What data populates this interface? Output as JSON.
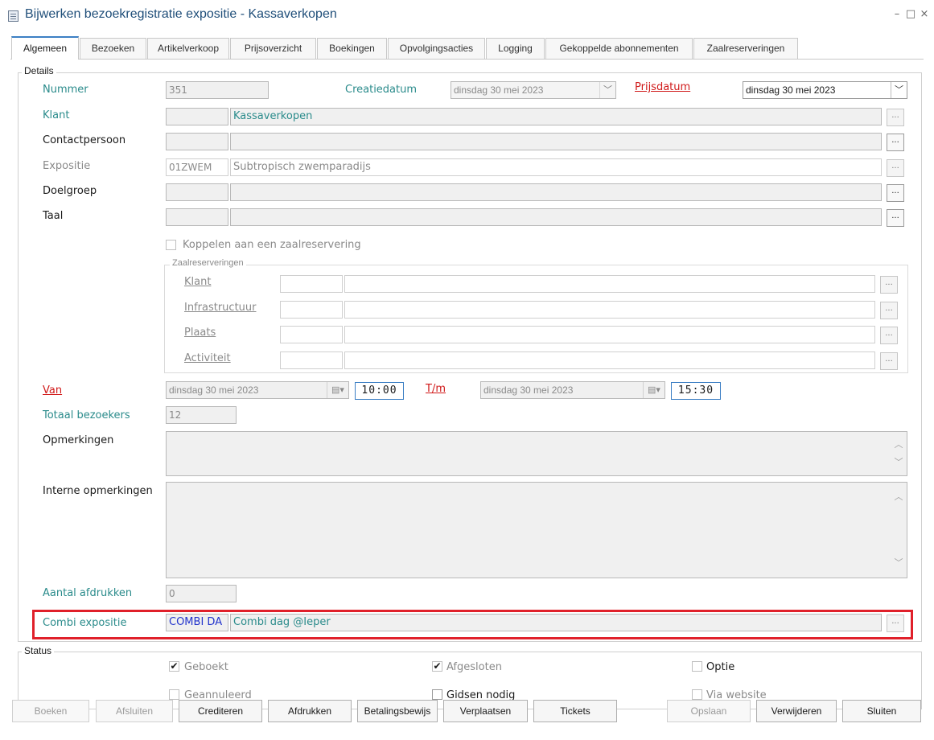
{
  "window": {
    "title": "Bijwerken bezoekregistratie expositie - Kassaverkopen",
    "minimize": "–",
    "maximize": "□",
    "close": "×"
  },
  "tabs": [
    {
      "label": "Algemeen",
      "active": true
    },
    {
      "label": "Bezoeken"
    },
    {
      "label": "Artikelverkoop"
    },
    {
      "label": "Prijsoverzicht"
    },
    {
      "label": "Boekingen"
    },
    {
      "label": "Opvolgingsacties"
    },
    {
      "label": "Logging"
    },
    {
      "label": "Gekoppelde abonnementen"
    },
    {
      "label": "Zaalreserveringen"
    }
  ],
  "details": {
    "group_label": "Details",
    "nummer_label": "Nummer",
    "nummer_value": "351",
    "creatiedatum_label": "Creatiedatum",
    "creatiedatum_value": "dinsdag 30 mei 2023",
    "prijsdatum_label": "Prijsdatum",
    "prijsdatum_value": "dinsdag 30 mei 2023",
    "klant_label": "Klant",
    "klant_code": "",
    "klant_name": "Kassaverkopen",
    "contactpersoon_label": "Contactpersoon",
    "expositie_label": "Expositie",
    "expositie_code": "01ZWEM",
    "expositie_name": "Subtropisch zwemparadijs",
    "doelgroep_label": "Doelgroep",
    "taal_label": "Taal",
    "koppelen_label": "Koppelen aan een zaalreservering",
    "ellipsis": "..."
  },
  "zaalreserveringen": {
    "group_label": "Zaalreserveringen",
    "klant_label": "Klant",
    "infrastructuur_label": "Infrastructuur",
    "plaats_label": "Plaats",
    "activiteit_label": "Activiteit"
  },
  "period": {
    "van_label": "Van",
    "van_date": "dinsdag 30 mei 2023",
    "van_time": "10:00",
    "tm_label": "T/m",
    "tm_date": "dinsdag 30 mei 2023",
    "tm_time": "15:30"
  },
  "totaal_bezoekers_label": "Totaal bezoekers",
  "totaal_bezoekers_value": "12",
  "opmerkingen_label": "Opmerkingen",
  "interne_opmerkingen_label": "Interne opmerkingen",
  "aantal_afdrukken_label": "Aantal afdrukken",
  "aantal_afdrukken_value": "0",
  "combi": {
    "label": "Combi expositie",
    "code": "COMBI DA",
    "name": "Combi dag @Ieper"
  },
  "status": {
    "group_label": "Status",
    "geboekt": {
      "label": "Geboekt",
      "checked": true
    },
    "afgesloten": {
      "label": "Afgesloten",
      "checked": true
    },
    "optie": {
      "label": "Optie",
      "checked": false
    },
    "geannuleerd": {
      "label": "Geannuleerd",
      "checked": false
    },
    "gidsen_nodig": {
      "label": "Gidsen nodig",
      "checked": false
    },
    "via_website": {
      "label": "Via website",
      "checked": false
    }
  },
  "buttons": {
    "boeken": "Boeken",
    "afsluiten": "Afsluiten",
    "crediteren": "Crediteren",
    "afdrukken": "Afdrukken",
    "betalingsbewijs": "Betalingsbewijs",
    "verplaatsen": "Verplaatsen",
    "tickets": "Tickets",
    "opslaan": "Opslaan",
    "verwijderen": "Verwijderen",
    "sluiten": "Sluiten"
  },
  "icons": {
    "dropdown": "chevron-down-icon",
    "calendar": "calendar-icon",
    "check": "✔"
  },
  "colors": {
    "accent": "#3c7fc4",
    "teal_label": "#2a8b8b",
    "required_label": "#d01818",
    "highlight": "#e0202a"
  }
}
